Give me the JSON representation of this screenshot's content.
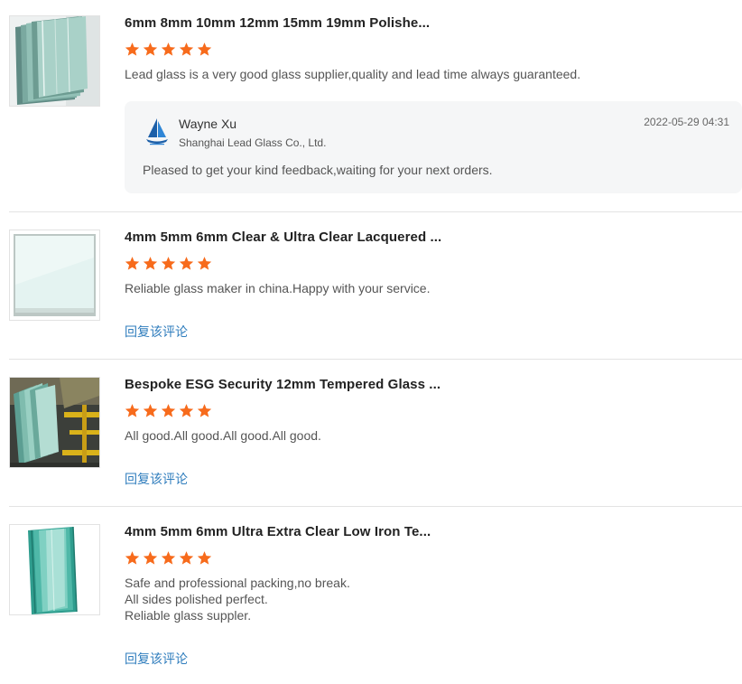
{
  "colors": {
    "star": "#f76b1c",
    "link": "#2f7dbd",
    "divider": "#e3e3e3",
    "reply_bg": "#f5f6f7"
  },
  "reviews": [
    {
      "product_title": "6mm 8mm 10mm 12mm 15mm 19mm Polishe...",
      "rating": 5,
      "comment_lines": [
        "Lead glass is a very good glass supplier,quality and lead time always guaranteed."
      ],
      "thumbnail_icon": "glass-sheets-stack-icon",
      "reply": {
        "name": "Wayne Xu",
        "company": "Shanghai Lead Glass Co., Ltd.",
        "date": "2022-05-29 04:31",
        "text": "Pleased to get your kind feedback,waiting for your next orders.",
        "logo_icon": "sailboat-logo-icon"
      }
    },
    {
      "product_title": "4mm 5mm 6mm Clear & Ultra Clear Lacquered ...",
      "rating": 5,
      "comment_lines": [
        "Reliable glass maker in china.Happy with your service."
      ],
      "thumbnail_icon": "lacquered-glass-panel-icon",
      "reply_link": "回复该评论"
    },
    {
      "product_title": "Bespoke ESG Security 12mm Tempered Glass ...",
      "rating": 5,
      "comment_lines": [
        "All good.All good.All good.All good."
      ],
      "thumbnail_icon": "tempered-glass-rack-icon",
      "reply_link": "回复该评论"
    },
    {
      "product_title": "4mm 5mm 6mm Ultra Extra Clear Low Iron Te...",
      "rating": 5,
      "comment_lines": [
        "Safe and professional packing,no break.",
        "All sides polished perfect.",
        "Reliable glass suppler."
      ],
      "thumbnail_icon": "low-iron-glass-edge-icon",
      "reply_link": "回复该评论"
    }
  ]
}
